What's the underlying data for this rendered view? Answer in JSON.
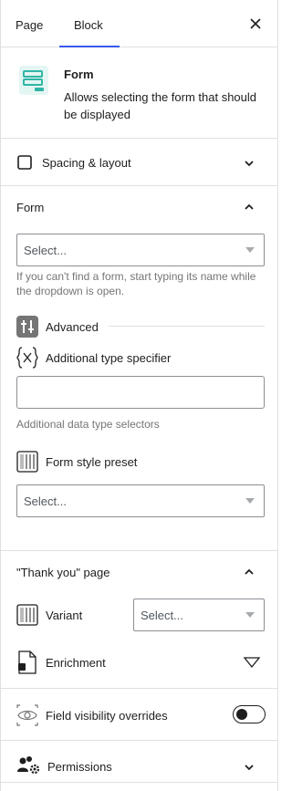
{
  "tabs": {
    "page": "Page",
    "block": "Block"
  },
  "block_card": {
    "title": "Form",
    "description": "Allows selecting the form that should be displayed"
  },
  "spacing": {
    "title": "Spacing & layout"
  },
  "form_section": {
    "title": "Form",
    "select_placeholder": "Select...",
    "help": "If you can't find a form, start typing its name while the dropdown is open.",
    "advanced_label": "Advanced",
    "type_specifier_label": "Additional type specifier",
    "type_specifier_value": "",
    "type_specifier_help": "Additional data type selectors",
    "style_preset_label": "Form style preset",
    "style_preset_placeholder": "Select..."
  },
  "thank_you": {
    "title": "\"Thank you\" page",
    "variant_label": "Variant",
    "variant_placeholder": "Select...",
    "enrichment_label": "Enrichment"
  },
  "field_visibility": {
    "label": "Field visibility overrides",
    "enabled": false
  },
  "permissions": {
    "label": "Permissions"
  },
  "colors": {
    "accent": "#3858e9",
    "block_icon": "#2fb5a5"
  }
}
